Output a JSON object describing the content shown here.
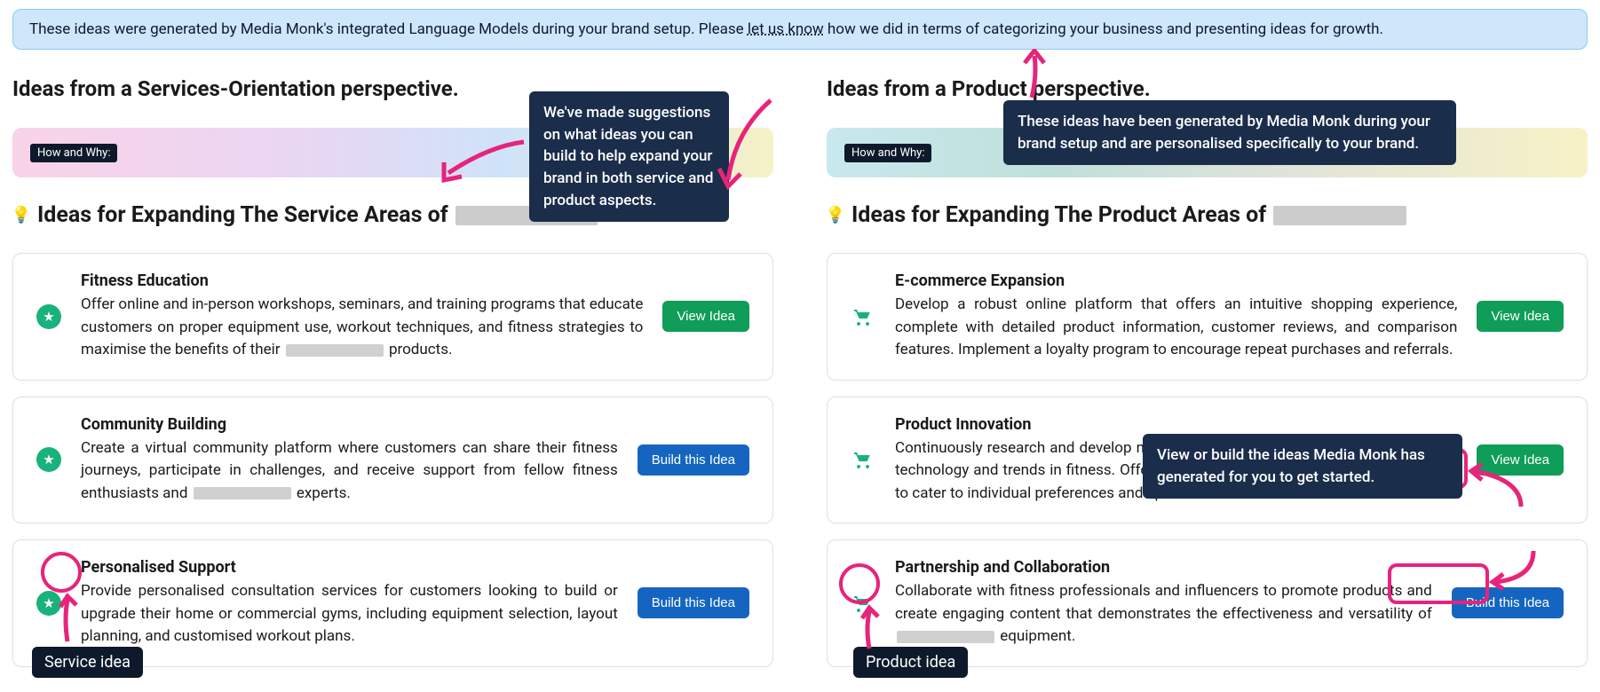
{
  "banner": {
    "pre": "These ideas were generated by Media Monk's integrated Language Models during your brand setup. Please ",
    "link": "let us know",
    "post": " how we did in terms of categorizing your business and presenting ideas for growth."
  },
  "tooltips": {
    "suggestions": "We've made suggestions on what ideas you can build to help expand your brand in both service and product aspects.",
    "generated": "These ideas have been generated by Media Monk during your brand setup and are personalised specifically to your brand.",
    "viewbuild": "View or build the ideas Media Monk has generated for you to get started."
  },
  "left": {
    "perspective": "Ideas from a Services-Orientation perspective.",
    "howwhy": "How and Why:",
    "expand": "Ideas for Expanding The Service Areas of",
    "ideas": [
      {
        "title": "Fitness Education",
        "desc_pre": "Offer online and in-person workshops, seminars, and training programs that educate customers on proper equipment use, workout techniques, and fitness strategies to maximise the benefits of their ",
        "desc_post": " products.",
        "action": "view"
      },
      {
        "title": "Community Building",
        "desc_pre": "Create a virtual community platform where customers can share their fitness journeys, participate in challenges, and receive support from fellow fitness enthusiasts and ",
        "desc_post": " experts.",
        "action": "build"
      },
      {
        "title": "Personalised Support",
        "desc_pre": "Provide personalised consultation services for customers looking to build or upgrade their home or commercial gyms, including equipment selection, layout planning, and customised workout plans.",
        "desc_post": "",
        "action": "build"
      }
    ],
    "badge": "Service idea"
  },
  "right": {
    "perspective": "Ideas from a Product perspective.",
    "howwhy": "How and Why:",
    "expand": "Ideas for Expanding The Product Areas of",
    "ideas": [
      {
        "title": "E-commerce Expansion",
        "desc_pre": "Develop a robust online platform that offers an intuitive shopping experience, complete with detailed product information, customer reviews, and comparison features. Implement a loyalty program to encourage repeat purchases and referrals.",
        "desc_post": "",
        "action": "view"
      },
      {
        "title": "Product Innovation",
        "desc_pre": "Continuously research and develop new fitness products that incorporate the latest technology and trends in fitness. Offer customisation options for home gym setups to cater to individual preferences and space constraints.",
        "desc_post": "",
        "action": "view"
      },
      {
        "title": "Partnership and Collaboration",
        "desc_pre": "Collaborate with fitness professionals and influencers to promote products and create engaging content that demonstrates the effectiveness and versatility of ",
        "desc_post": " equipment.",
        "action": "build"
      }
    ],
    "badge": "Product idea"
  },
  "buttons": {
    "view": "View Idea",
    "build": "Build this Idea"
  }
}
